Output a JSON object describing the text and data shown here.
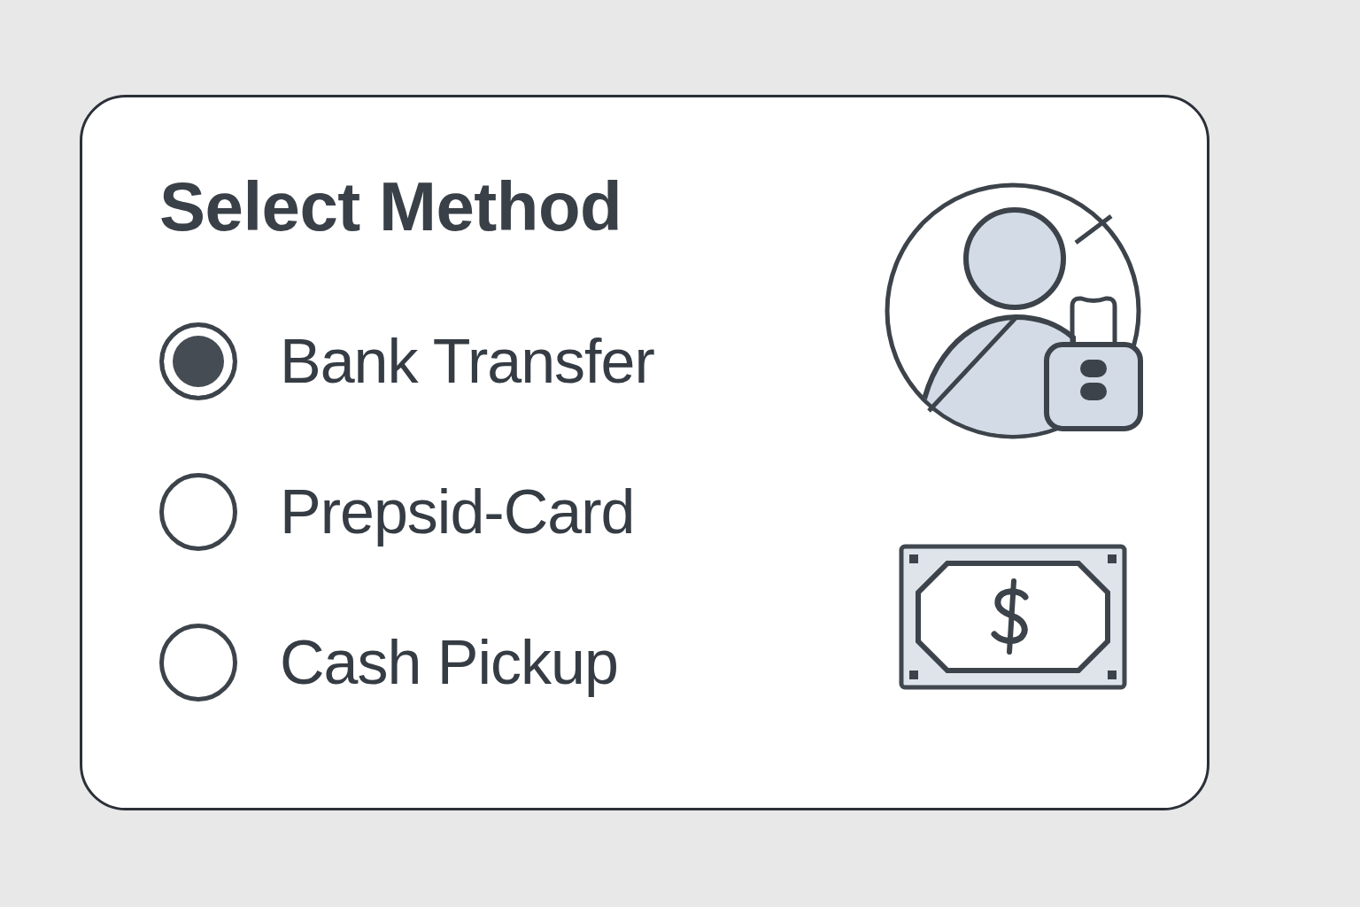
{
  "title": "Select Method",
  "options": [
    {
      "label": "Bank Transfer",
      "selected": true
    },
    {
      "label": "Prepsid-Card",
      "selected": false
    },
    {
      "label": "Cash Pickup",
      "selected": false
    }
  ]
}
